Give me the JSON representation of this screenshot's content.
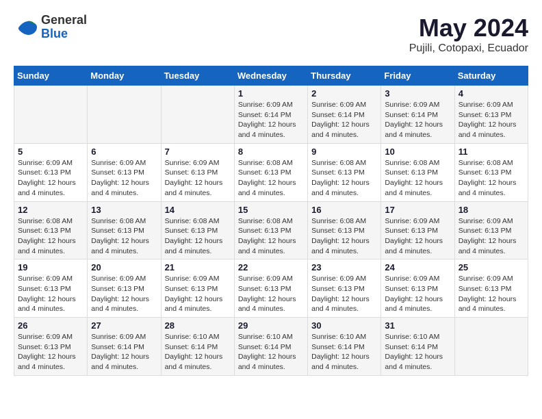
{
  "logo": {
    "general": "General",
    "blue": "Blue"
  },
  "title": "May 2024",
  "subtitle": "Pujili, Cotopaxi, Ecuador",
  "headers": [
    "Sunday",
    "Monday",
    "Tuesday",
    "Wednesday",
    "Thursday",
    "Friday",
    "Saturday"
  ],
  "weeks": [
    [
      {
        "day": "",
        "info": ""
      },
      {
        "day": "",
        "info": ""
      },
      {
        "day": "",
        "info": ""
      },
      {
        "day": "1",
        "info": "Sunrise: 6:09 AM\nSunset: 6:14 PM\nDaylight: 12 hours\nand 4 minutes."
      },
      {
        "day": "2",
        "info": "Sunrise: 6:09 AM\nSunset: 6:14 PM\nDaylight: 12 hours\nand 4 minutes."
      },
      {
        "day": "3",
        "info": "Sunrise: 6:09 AM\nSunset: 6:14 PM\nDaylight: 12 hours\nand 4 minutes."
      },
      {
        "day": "4",
        "info": "Sunrise: 6:09 AM\nSunset: 6:13 PM\nDaylight: 12 hours\nand 4 minutes."
      }
    ],
    [
      {
        "day": "5",
        "info": "Sunrise: 6:09 AM\nSunset: 6:13 PM\nDaylight: 12 hours\nand 4 minutes."
      },
      {
        "day": "6",
        "info": "Sunrise: 6:09 AM\nSunset: 6:13 PM\nDaylight: 12 hours\nand 4 minutes."
      },
      {
        "day": "7",
        "info": "Sunrise: 6:09 AM\nSunset: 6:13 PM\nDaylight: 12 hours\nand 4 minutes."
      },
      {
        "day": "8",
        "info": "Sunrise: 6:08 AM\nSunset: 6:13 PM\nDaylight: 12 hours\nand 4 minutes."
      },
      {
        "day": "9",
        "info": "Sunrise: 6:08 AM\nSunset: 6:13 PM\nDaylight: 12 hours\nand 4 minutes."
      },
      {
        "day": "10",
        "info": "Sunrise: 6:08 AM\nSunset: 6:13 PM\nDaylight: 12 hours\nand 4 minutes."
      },
      {
        "day": "11",
        "info": "Sunrise: 6:08 AM\nSunset: 6:13 PM\nDaylight: 12 hours\nand 4 minutes."
      }
    ],
    [
      {
        "day": "12",
        "info": "Sunrise: 6:08 AM\nSunset: 6:13 PM\nDaylight: 12 hours\nand 4 minutes."
      },
      {
        "day": "13",
        "info": "Sunrise: 6:08 AM\nSunset: 6:13 PM\nDaylight: 12 hours\nand 4 minutes."
      },
      {
        "day": "14",
        "info": "Sunrise: 6:08 AM\nSunset: 6:13 PM\nDaylight: 12 hours\nand 4 minutes."
      },
      {
        "day": "15",
        "info": "Sunrise: 6:08 AM\nSunset: 6:13 PM\nDaylight: 12 hours\nand 4 minutes."
      },
      {
        "day": "16",
        "info": "Sunrise: 6:08 AM\nSunset: 6:13 PM\nDaylight: 12 hours\nand 4 minutes."
      },
      {
        "day": "17",
        "info": "Sunrise: 6:09 AM\nSunset: 6:13 PM\nDaylight: 12 hours\nand 4 minutes."
      },
      {
        "day": "18",
        "info": "Sunrise: 6:09 AM\nSunset: 6:13 PM\nDaylight: 12 hours\nand 4 minutes."
      }
    ],
    [
      {
        "day": "19",
        "info": "Sunrise: 6:09 AM\nSunset: 6:13 PM\nDaylight: 12 hours\nand 4 minutes."
      },
      {
        "day": "20",
        "info": "Sunrise: 6:09 AM\nSunset: 6:13 PM\nDaylight: 12 hours\nand 4 minutes."
      },
      {
        "day": "21",
        "info": "Sunrise: 6:09 AM\nSunset: 6:13 PM\nDaylight: 12 hours\nand 4 minutes."
      },
      {
        "day": "22",
        "info": "Sunrise: 6:09 AM\nSunset: 6:13 PM\nDaylight: 12 hours\nand 4 minutes."
      },
      {
        "day": "23",
        "info": "Sunrise: 6:09 AM\nSunset: 6:13 PM\nDaylight: 12 hours\nand 4 minutes."
      },
      {
        "day": "24",
        "info": "Sunrise: 6:09 AM\nSunset: 6:13 PM\nDaylight: 12 hours\nand 4 minutes."
      },
      {
        "day": "25",
        "info": "Sunrise: 6:09 AM\nSunset: 6:13 PM\nDaylight: 12 hours\nand 4 minutes."
      }
    ],
    [
      {
        "day": "26",
        "info": "Sunrise: 6:09 AM\nSunset: 6:13 PM\nDaylight: 12 hours\nand 4 minutes."
      },
      {
        "day": "27",
        "info": "Sunrise: 6:09 AM\nSunset: 6:14 PM\nDaylight: 12 hours\nand 4 minutes."
      },
      {
        "day": "28",
        "info": "Sunrise: 6:10 AM\nSunset: 6:14 PM\nDaylight: 12 hours\nand 4 minutes."
      },
      {
        "day": "29",
        "info": "Sunrise: 6:10 AM\nSunset: 6:14 PM\nDaylight: 12 hours\nand 4 minutes."
      },
      {
        "day": "30",
        "info": "Sunrise: 6:10 AM\nSunset: 6:14 PM\nDaylight: 12 hours\nand 4 minutes."
      },
      {
        "day": "31",
        "info": "Sunrise: 6:10 AM\nSunset: 6:14 PM\nDaylight: 12 hours\nand 4 minutes."
      },
      {
        "day": "",
        "info": ""
      }
    ]
  ]
}
